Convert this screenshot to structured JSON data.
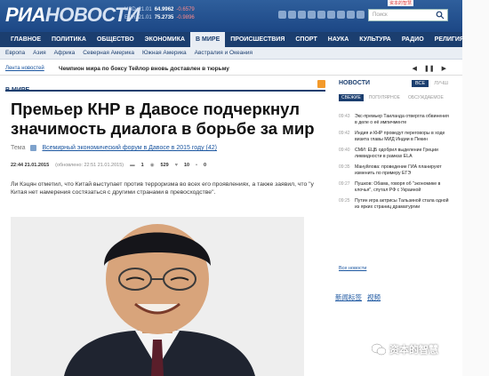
{
  "header": {
    "logo_main": "РИА",
    "logo_second": "НОВОСТИ",
    "rates": [
      {
        "code": "USD",
        "date": "21.01",
        "value": "64.9962",
        "change": "-0.6579"
      },
      {
        "code": "EUR",
        "date": "21.01",
        "value": "75.2735",
        "change": "-0.9896"
      }
    ],
    "search_placeholder": "Поиск",
    "top_watermark": "资本的智慧"
  },
  "nav": {
    "items": [
      "ГЛАВНОЕ",
      "ПОЛИТИКА",
      "ОБЩЕСТВО",
      "ЭКОНОМИКА",
      "В МИРЕ",
      "ПРОИСШЕСТВИЯ",
      "СПОРТ",
      "НАУКА",
      "КУЛЬТУРА",
      "РАДИО",
      "РЕЛИГИЯ"
    ],
    "active": "В МИРЕ"
  },
  "subnav": {
    "items": [
      "Европа",
      "Азия",
      "Африка",
      "Северная Америка",
      "Южная Америка",
      "Австралия и Океания"
    ]
  },
  "ticker": {
    "label": "Лента новостей",
    "text": "Чемпион мира по боксу Тейлор вновь доставлен в тюрьму"
  },
  "article": {
    "section": "В МИРЕ",
    "headline": "Премьер КНР в Давосе подчеркнул значимость диалога в борьбе за мир",
    "tema_label": "Тема",
    "tema_link": "Всемирный экономический форум в Давосе в 2015 году (42)",
    "time": "22:44 21.01.2015",
    "updated": "(обновлено: 22:51 21.01.2015)",
    "comments": "1",
    "views": "529",
    "likes": "10",
    "shares": "0",
    "lead": "Ли Кэцян отметил, что Китай выступает против терроризма во всех его проявлениях, а также заявил, что \"у Китая нет намерения состязаться с другими странами в превосходстве\"."
  },
  "news": {
    "title": "НОВОСТИ",
    "tabs1": [
      "ВСЕ",
      "ЛУЧШ"
    ],
    "tabs2": [
      "СВЕЖИЕ",
      "ПОПУЛЯРНОЕ",
      "ОБСУЖДАЕМОЕ"
    ],
    "items": [
      {
        "time": "09:43",
        "text": "Экс-премьер Таиланда отвергла обвинения в деле о её импичменте"
      },
      {
        "time": "09:42",
        "text": "Индия и КНР проведут переговоры в ходе визита главы МИД Индии в Пекин"
      },
      {
        "time": "09:40",
        "text": "СМИ: ЕЦБ одобрил выделение Греции ликвидности в рамках ELA"
      },
      {
        "time": "09:35",
        "text": "Мануйлова: проведение ГИА планируют изменить по примеру ЕГЭ"
      },
      {
        "time": "09:27",
        "text": "Пушков: Обама, говоря об \"экономике в клочья\", спутал РФ с Украиной"
      },
      {
        "time": "09:25",
        "text": "Путин игра актрисы Тальзиной стала одной из ярких страниц драматургии"
      }
    ],
    "all_label": "Все новости"
  },
  "promo": [
    "新闻标签",
    "视频"
  ],
  "watermark": "资本的智慧",
  "colors": {
    "brand": "#1b3e6f",
    "header": "#2f5f9c",
    "link": "#1b56a0",
    "rss": "#f39a2b"
  }
}
